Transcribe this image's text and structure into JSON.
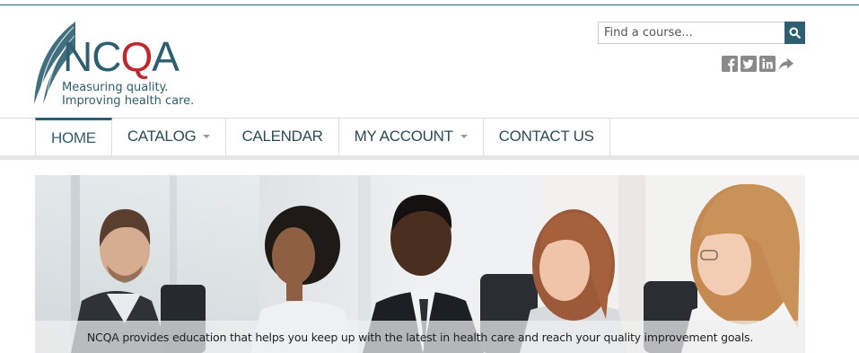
{
  "brand": {
    "wordmark_prefix": "NC",
    "wordmark_q": "Q",
    "wordmark_suffix": "A",
    "tagline_line1": "Measuring quality.",
    "tagline_line2": "Improving health care.",
    "primary_color": "#2d5f70",
    "accent_color": "#c0272d"
  },
  "search": {
    "placeholder": "Find a course...",
    "value": "",
    "button_icon": "search-icon"
  },
  "social": [
    {
      "name": "facebook-icon"
    },
    {
      "name": "twitter-icon"
    },
    {
      "name": "linkedin-icon"
    },
    {
      "name": "share-icon"
    }
  ],
  "nav": {
    "items": [
      {
        "label": "HOME",
        "active": true,
        "dropdown": false
      },
      {
        "label": "CATALOG",
        "active": false,
        "dropdown": true
      },
      {
        "label": "CALENDAR",
        "active": false,
        "dropdown": false
      },
      {
        "label": "MY ACCOUNT",
        "active": false,
        "dropdown": true
      },
      {
        "label": "CONTACT US",
        "active": false,
        "dropdown": false
      }
    ]
  },
  "hero": {
    "caption": "NCQA provides education that helps you keep up with the latest in health care and reach your quality improvement goals."
  }
}
